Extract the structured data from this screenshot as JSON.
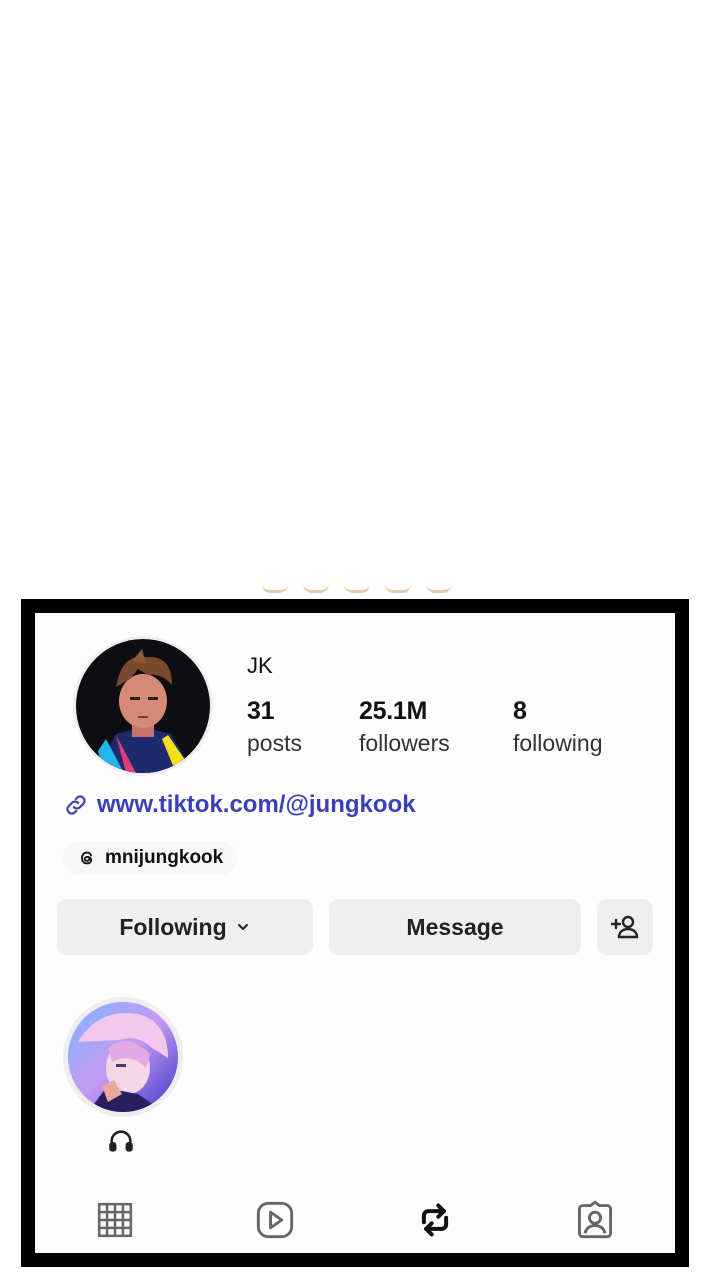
{
  "profile": {
    "username": "JK",
    "stats": [
      {
        "value": "31",
        "label": "posts"
      },
      {
        "value": "25.1M",
        "label": "followers"
      },
      {
        "value": "8",
        "label": "following"
      }
    ],
    "link": "www.tiktok.com/@jungkook",
    "threads_handle": "mnijungkook"
  },
  "actions": {
    "following_label": "Following",
    "message_label": "Message"
  },
  "icons": {
    "link": "link-icon",
    "threads": "threads-icon",
    "chevron": "chevron-down-icon",
    "add_user": "add-user-icon",
    "headphones": "headphones-icon",
    "grid": "grid-icon",
    "reels": "reels-icon",
    "reposts": "repost-icon",
    "tagged": "tagged-icon"
  },
  "colors": {
    "link": "#3b3fb8",
    "button_bg": "#efefef",
    "frame": "#000000"
  }
}
